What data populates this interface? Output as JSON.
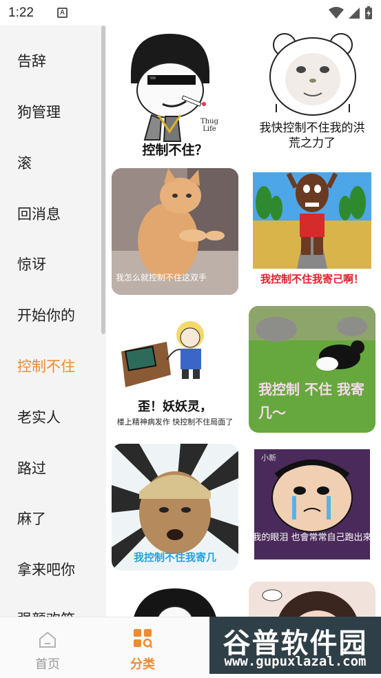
{
  "status_bar": {
    "time": "1:22",
    "notification_glyph": "A"
  },
  "sidebar": {
    "items": [
      {
        "label": "告辞",
        "active": false
      },
      {
        "label": "狗管理",
        "active": false
      },
      {
        "label": "滚",
        "active": false
      },
      {
        "label": "回消息",
        "active": false
      },
      {
        "label": "惊讶",
        "active": false
      },
      {
        "label": "开始你的",
        "active": false
      },
      {
        "label": "控制不住",
        "active": true
      },
      {
        "label": "老实人",
        "active": false
      },
      {
        "label": "路过",
        "active": false
      },
      {
        "label": "麻了",
        "active": false
      },
      {
        "label": "拿来吧你",
        "active": false
      },
      {
        "label": "强颜欢笑",
        "active": false
      }
    ]
  },
  "stickers": [
    {
      "caption": "控制不住？",
      "extra": "Thug Life"
    },
    {
      "caption": "我快控制不住我的洪荒之力了"
    },
    {
      "caption": "我怎么就控制不住这双手"
    },
    {
      "caption": "我控制不住我寄己啊！"
    },
    {
      "caption": "歪！妖妖灵，",
      "sub": "楼上精神病发作  快控制不住局面了"
    },
    {
      "caption": "我控制 不住 我寄几～"
    },
    {
      "caption": "我控制不住我寄几"
    },
    {
      "caption": "我的眼泪 也會常常自己跑出來",
      "extra": "小新"
    },
    {
      "caption": ""
    },
    {
      "caption": ""
    }
  ],
  "bottom_nav": {
    "tabs": [
      {
        "label": "首页",
        "active": false
      },
      {
        "label": "分类",
        "active": true
      }
    ]
  },
  "watermark": {
    "title": "谷普软件园",
    "url": "www.gupuxlazal.com"
  },
  "colors": {
    "accent": "#f08a2e",
    "sidebar_bg": "#f4f4f4",
    "text": "#222222",
    "inactive_tab": "#9a9a9a"
  }
}
